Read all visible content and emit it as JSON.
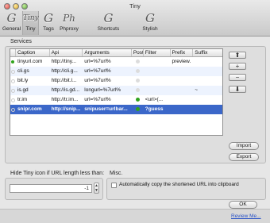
{
  "window": {
    "title": "Tiny"
  },
  "toolbar": [
    {
      "label": "General",
      "icon": "G"
    },
    {
      "label": "Tiny",
      "icon": "Tiny"
    },
    {
      "label": "Tags",
      "icon": "G"
    },
    {
      "label": "Phproxy",
      "icon": "Ph"
    },
    {
      "label": "Shortcuts",
      "icon": "G"
    },
    {
      "label": "Stylish",
      "icon": "G"
    }
  ],
  "services": {
    "section_label": "Services",
    "columns": [
      "",
      "Caption",
      "Api",
      "Arguments",
      "Post",
      "Filter",
      "Prefix",
      "Suffix"
    ],
    "rows": [
      {
        "enabled": true,
        "caption": "tinyurl.com",
        "api": "http://tiny...",
        "arguments": "url=%7url%",
        "post": false,
        "filter": "",
        "prefix": "preview.",
        "suffix": ""
      },
      {
        "enabled": false,
        "caption": "cli.gs",
        "api": "http://cli.g...",
        "arguments": "url=%7url%",
        "post": false,
        "filter": "",
        "prefix": "",
        "suffix": ""
      },
      {
        "enabled": false,
        "caption": "bit.ly",
        "api": "http://bit.l...",
        "arguments": "url=%7url%",
        "post": false,
        "filter": "",
        "prefix": "",
        "suffix": ""
      },
      {
        "enabled": false,
        "caption": "is.gd",
        "api": "http://is.gd...",
        "arguments": "longurl=%7url%",
        "post": false,
        "filter": "",
        "prefix": "",
        "suffix": "~"
      },
      {
        "enabled": false,
        "caption": "tr.im",
        "api": "http://tr.im...",
        "arguments": "url=%7url%",
        "post": true,
        "filter": "<url>(...",
        "prefix": "",
        "suffix": ""
      },
      {
        "enabled": false,
        "caption": "snipr.com",
        "api": "http://snip...",
        "arguments": "snipuser=urlbar...",
        "post": true,
        "filter": "?guess",
        "prefix": "",
        "suffix": ""
      }
    ],
    "move_up": "⬆",
    "add": "+",
    "remove": "−",
    "move_down": "⬇",
    "import_label": "Import",
    "export_label": "Export"
  },
  "hide": {
    "label": "Hide Tiny icon if URL length less than:",
    "value": "-1"
  },
  "misc": {
    "label": "Misc.",
    "checkbox_label": "Automatically copy the shortened URL into clipboard",
    "checked": false
  },
  "footer": {
    "ok_label": "OK",
    "review_link": "Review Me..."
  }
}
